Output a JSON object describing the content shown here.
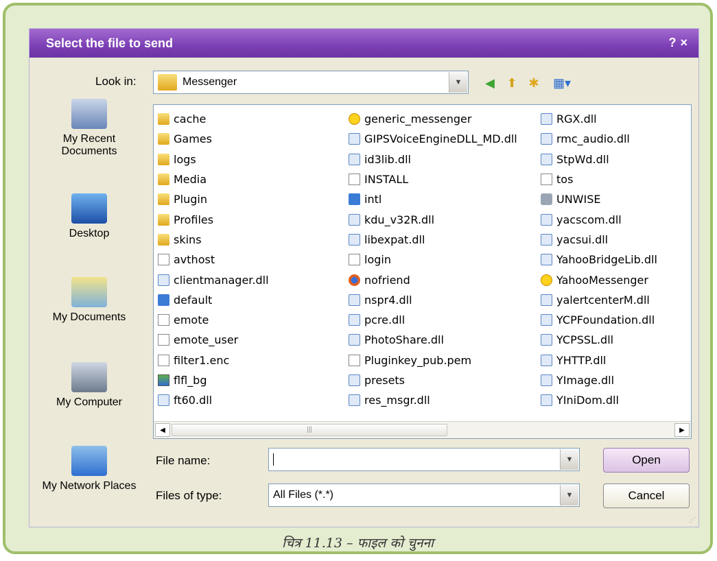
{
  "dialog": {
    "title": "Select the file to send",
    "help_glyph": "?",
    "close_glyph": "×"
  },
  "look_in": {
    "label": "Look in:",
    "value": "Messenger"
  },
  "places": [
    {
      "name": "recent",
      "label": "My Recent Documents"
    },
    {
      "name": "desktop",
      "label": "Desktop"
    },
    {
      "name": "documents",
      "label": "My Documents"
    },
    {
      "name": "computer",
      "label": "My Computer"
    },
    {
      "name": "network",
      "label": "My Network Places"
    }
  ],
  "files": {
    "col1": [
      {
        "name": "cache",
        "type": "folder"
      },
      {
        "name": "Games",
        "type": "folder"
      },
      {
        "name": "logs",
        "type": "folder"
      },
      {
        "name": "Media",
        "type": "folder"
      },
      {
        "name": "Plugin",
        "type": "folder"
      },
      {
        "name": "Profiles",
        "type": "folder"
      },
      {
        "name": "skins",
        "type": "folder"
      },
      {
        "name": "avthost",
        "type": "file"
      },
      {
        "name": "clientmanager.dll",
        "type": "dll"
      },
      {
        "name": "default",
        "type": "app"
      },
      {
        "name": "emote",
        "type": "file"
      },
      {
        "name": "emote_user",
        "type": "file"
      },
      {
        "name": "filter1.enc",
        "type": "file"
      },
      {
        "name": "flfl_bg",
        "type": "img"
      },
      {
        "name": "ft60.dll",
        "type": "dll"
      }
    ],
    "col2": [
      {
        "name": "generic_messenger",
        "type": "smiley"
      },
      {
        "name": "GIPSVoiceEngineDLL_MD.dll",
        "type": "dll"
      },
      {
        "name": "id3lib.dll",
        "type": "dll"
      },
      {
        "name": "INSTALL",
        "type": "file"
      },
      {
        "name": "intl",
        "type": "app"
      },
      {
        "name": "kdu_v32R.dll",
        "type": "dll"
      },
      {
        "name": "libexpat.dll",
        "type": "dll"
      },
      {
        "name": "login",
        "type": "file"
      },
      {
        "name": "nofriend",
        "type": "firefox"
      },
      {
        "name": "nspr4.dll",
        "type": "dll"
      },
      {
        "name": "pcre.dll",
        "type": "dll"
      },
      {
        "name": "PhotoShare.dll",
        "type": "dll"
      },
      {
        "name": "Pluginkey_pub.pem",
        "type": "file"
      },
      {
        "name": "presets",
        "type": "dll"
      },
      {
        "name": "res_msgr.dll",
        "type": "dll"
      }
    ],
    "col3": [
      {
        "name": "RGX.dll",
        "type": "dll"
      },
      {
        "name": "rmc_audio.dll",
        "type": "dll"
      },
      {
        "name": "StpWd.dll",
        "type": "dll"
      },
      {
        "name": "tos",
        "type": "file"
      },
      {
        "name": "UNWISE",
        "type": "setup"
      },
      {
        "name": "yacscom.dll",
        "type": "dll"
      },
      {
        "name": "yacsui.dll",
        "type": "dll"
      },
      {
        "name": "YahooBridgeLib.dll",
        "type": "dll"
      },
      {
        "name": "YahooMessenger",
        "type": "smiley"
      },
      {
        "name": "yalertcenterM.dll",
        "type": "dll"
      },
      {
        "name": "YCPFoundation.dll",
        "type": "dll"
      },
      {
        "name": "YCPSSL.dll",
        "type": "dll"
      },
      {
        "name": "YHTTP.dll",
        "type": "dll"
      },
      {
        "name": "YImage.dll",
        "type": "dll"
      },
      {
        "name": "YIniDom.dll",
        "type": "dll"
      }
    ]
  },
  "file_name": {
    "label": "File name:",
    "value": ""
  },
  "file_type": {
    "label": "Files of type:",
    "value": "All Files (*.*)"
  },
  "buttons": {
    "open": "Open",
    "cancel": "Cancel"
  },
  "caption": "चित्र 11.13 – फाइल को चुनना",
  "colors": {
    "titlebar": "#7c3fb5",
    "frame": "#9fbf6a",
    "dialog_bg": "#ece9d8"
  }
}
